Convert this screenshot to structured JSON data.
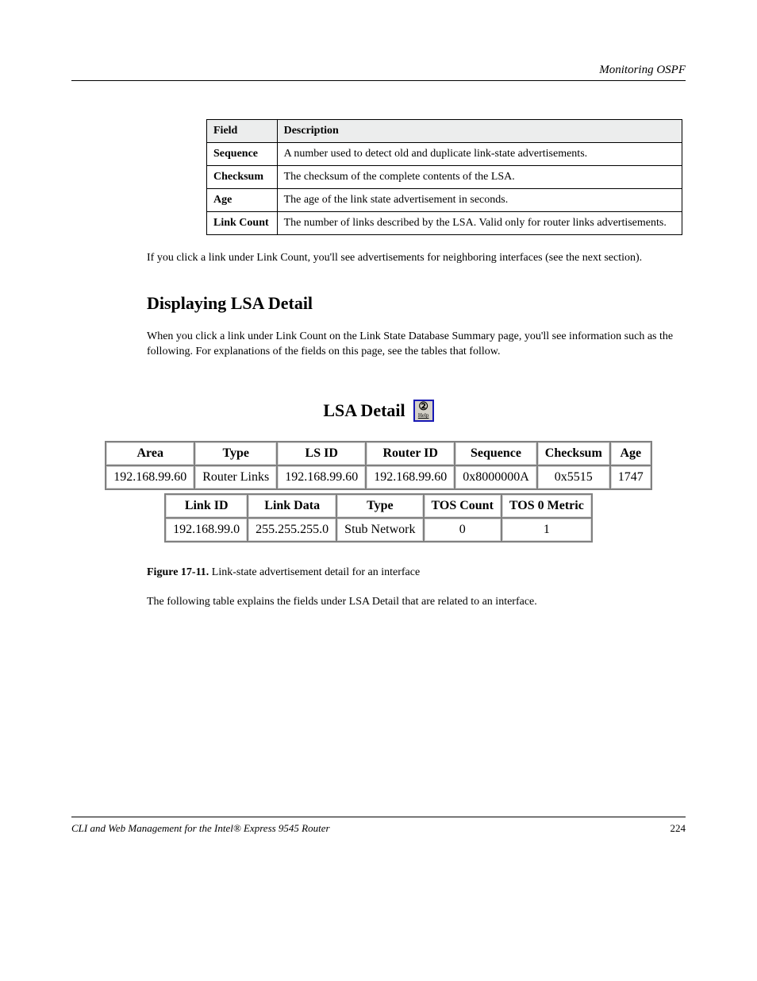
{
  "header_right": "Monitoring OSPF",
  "def_table_headers": {
    "field": "Field",
    "desc": "Description"
  },
  "def_rows": [
    {
      "field": "Sequence",
      "desc": "A number used to detect old and duplicate link-state advertisements."
    },
    {
      "field": "Checksum",
      "desc": "The checksum of the complete contents of the LSA."
    },
    {
      "field": "Age",
      "desc": "The age of the link state advertisement in seconds."
    },
    {
      "field": "Link Count",
      "desc": "The number of links described by the LSA. Valid only for router links advertisements."
    }
  ],
  "para1": "If you click a link under Link Count, you'll see advertisements for neighboring interfaces (see the next section).",
  "section_h2": "Displaying LSA Detail",
  "section_intro": "When you click a link under Link Count on the Link State Database Summary page, you'll see information such as the following. For explanations of the fields on this page, see the tables that follow.",
  "lsa_title": "LSA Detail",
  "help_icon": {
    "glyph": "②",
    "label": "Help"
  },
  "lsa_table1": {
    "headers": [
      "Area",
      "Type",
      "LS ID",
      "Router ID",
      "Sequence",
      "Checksum",
      "Age"
    ],
    "row": [
      "192.168.99.60",
      "Router Links",
      "192.168.99.60",
      "192.168.99.60",
      "0x8000000A",
      "0x5515",
      "1747"
    ]
  },
  "lsa_table2": {
    "headers": [
      "Link ID",
      "Link Data",
      "Type",
      "TOS Count",
      "TOS 0 Metric"
    ],
    "row": [
      "192.168.99.0",
      "255.255.255.0",
      "Stub Network",
      "0",
      "1"
    ]
  },
  "figure": {
    "label": "Figure 17-11.",
    "text": "Link-state advertisement detail for an interface"
  },
  "body_after": "The following table explains the fields under LSA Detail that are related to an interface.",
  "footer_left": "CLI and Web Management for the Intel® Express 9545 Router",
  "footer_right": "224"
}
